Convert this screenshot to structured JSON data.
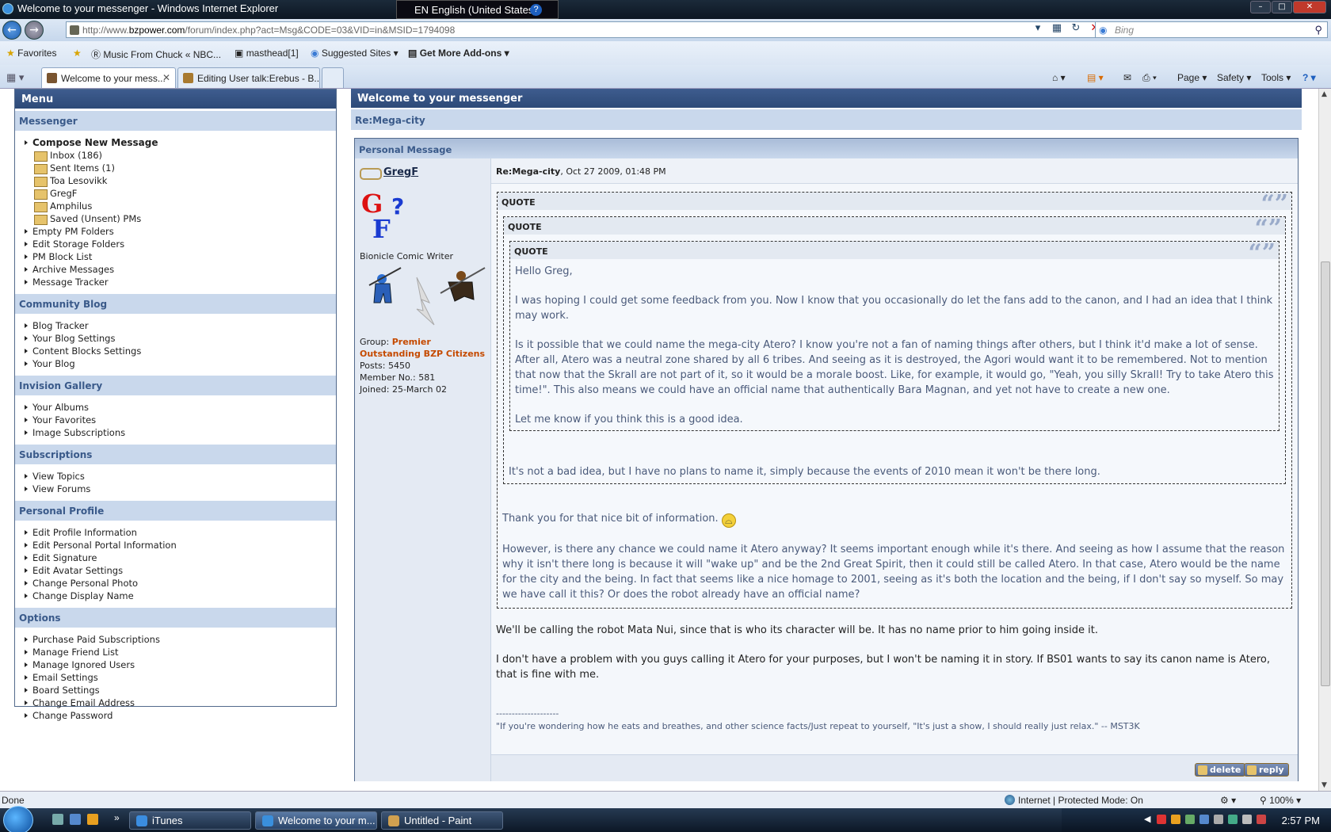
{
  "browser": {
    "window_title": "Welcome to your messenger - Windows Internet Explorer",
    "language_bar": "EN English (United States)",
    "language_help": "?",
    "url_prefix": "http://www.",
    "url_domain": "bzpower.com",
    "url_path": "/forum/index.php?act=Msg&CODE=03&VID=in&MSID=1794098",
    "search_placeholder": "Bing",
    "favorites_label": "Favorites",
    "favorites_bar": [
      "Music From Chuck « NBC...",
      "masthead[1]",
      "Suggested Sites",
      "Get More Add-ons"
    ],
    "tabs": [
      {
        "label": "Welcome to your mess...",
        "active": true
      },
      {
        "label": "Editing User talk:Erebus - B...",
        "active": false
      }
    ],
    "commands": [
      "Page",
      "Safety",
      "Tools"
    ],
    "status_left": "Done",
    "status_zone": "Internet | Protected Mode: On",
    "zoom": "100%"
  },
  "sidebar": {
    "title": "Menu",
    "sections": [
      {
        "title": "Messenger",
        "items": [
          {
            "label": "Compose New Message",
            "kind": "arrow",
            "bold": true
          },
          {
            "label": "Inbox (186)",
            "kind": "folder"
          },
          {
            "label": "Sent Items (1)",
            "kind": "folder"
          },
          {
            "label": "Toa Lesovikk",
            "kind": "folder"
          },
          {
            "label": "GregF",
            "kind": "folder"
          },
          {
            "label": "Amphilus",
            "kind": "folder"
          },
          {
            "label": "Saved (Unsent) PMs",
            "kind": "folder"
          },
          {
            "label": "Empty PM Folders",
            "kind": "arrow"
          },
          {
            "label": "Edit Storage Folders",
            "kind": "arrow"
          },
          {
            "label": "PM Block List",
            "kind": "arrow"
          },
          {
            "label": "Archive Messages",
            "kind": "arrow"
          },
          {
            "label": "Message Tracker",
            "kind": "arrow"
          }
        ]
      },
      {
        "title": "Community Blog",
        "items": [
          {
            "label": "Blog Tracker",
            "kind": "arrow"
          },
          {
            "label": "Your Blog Settings",
            "kind": "arrow"
          },
          {
            "label": "Content Blocks Settings",
            "kind": "arrow"
          },
          {
            "label": "Your Blog",
            "kind": "arrow"
          }
        ]
      },
      {
        "title": "Invision Gallery",
        "items": [
          {
            "label": "Your Albums",
            "kind": "arrow"
          },
          {
            "label": "Your Favorites",
            "kind": "arrow"
          },
          {
            "label": "Image Subscriptions",
            "kind": "arrow"
          }
        ]
      },
      {
        "title": "Subscriptions",
        "items": [
          {
            "label": "View Topics",
            "kind": "arrow"
          },
          {
            "label": "View Forums",
            "kind": "arrow"
          }
        ]
      },
      {
        "title": "Personal Profile",
        "items": [
          {
            "label": "Edit Profile Information",
            "kind": "arrow"
          },
          {
            "label": "Edit Personal Portal Information",
            "kind": "arrow"
          },
          {
            "label": "Edit Signature",
            "kind": "arrow"
          },
          {
            "label": "Edit Avatar Settings",
            "kind": "arrow"
          },
          {
            "label": "Change Personal Photo",
            "kind": "arrow"
          },
          {
            "label": "Change Display Name",
            "kind": "arrow"
          }
        ]
      },
      {
        "title": "Options",
        "items": [
          {
            "label": "Purchase Paid Subscriptions",
            "kind": "arrow"
          },
          {
            "label": "Manage Friend List",
            "kind": "arrow"
          },
          {
            "label": "Manage Ignored Users",
            "kind": "arrow"
          },
          {
            "label": "Email Settings",
            "kind": "arrow"
          },
          {
            "label": "Board Settings",
            "kind": "arrow"
          },
          {
            "label": "Change Email Address",
            "kind": "arrow"
          },
          {
            "label": "Change Password",
            "kind": "arrow"
          }
        ]
      }
    ]
  },
  "main": {
    "title": "Welcome to your messenger",
    "subject": "Re:Mega-city",
    "pm_header": "Personal Message",
    "author": {
      "name": "GregF",
      "title": "Bionicle Comic Writer",
      "group_label": "Group:",
      "group_line1": "Premier",
      "group_line2": "Outstanding BZP Citizens",
      "posts": "Posts: 5450",
      "member_no": "Member No.: 581",
      "joined": "Joined: 25-March 02"
    },
    "message_subject": "Re:Mega-city",
    "message_date": ", Oct 27 2009, 01:48 PM",
    "quote_label": "QUOTE",
    "quote3": [
      "Hello Greg,",
      "I was hoping I could get some feedback from you. Now I know that you occasionally do let the fans add to the canon, and I had an idea that I think may work.",
      "Is it possible that we could name the mega-city Atero? I know you're not a fan of naming things after others, but I think it'd make a lot of sense. After all, Atero was a neutral zone shared by all 6 tribes. And seeing as it is destroyed, the Agori would want it to be remembered. Not to mention that now that the Skrall are not part of it, so it would be a morale boost. Like, for example, it would go, \"Yeah, you silly Skrall! Try to take Atero this time!\". This also means we could have an official name that authentically Bara Magnan, and yet not have to create a new one.",
      "Let me know if you think this is a good idea."
    ],
    "quote2_reply": "It's not a bad idea, but I have no plans to name it, simply because the events of 2010 mean it won't be there long.",
    "quote1_reply": [
      "Thank you for that nice bit of information.",
      "However, is there any chance we could name it Atero anyway? It seems important enough while it's there. And seeing as how I assume that the reason why it isn't there long is because it will \"wake up\" and be the 2nd Great Spirit, then it could still be called Atero. In that case, Atero would be the name for the city and the being. In fact that seems like a nice homage to 2001, seeing as it's both the location and the being, if I don't say so myself. So may we have call it this? Or does the robot already have an official name?"
    ],
    "reply": [
      "We'll be calling the robot Mata Nui, since that is who its character will be. It has no name prior to him going inside it.",
      "I don't have a problem with you guys calling it Atero for your purposes, but I won't be naming it in story. If BS01 wants to say its canon name is Atero, that is fine with me."
    ],
    "sig_divider": "--------------------",
    "signature": "\"If you're wondering how he eats and breathes, and other science facts/Just repeat to yourself, \"It's just a show, I should really just relax.\" -- MST3K",
    "delete_label": "delete",
    "reply_label": "reply"
  },
  "taskbar": {
    "items": [
      "iTunes",
      "Welcome to your m...",
      "Untitled - Paint"
    ],
    "clock": "2:57 PM"
  }
}
